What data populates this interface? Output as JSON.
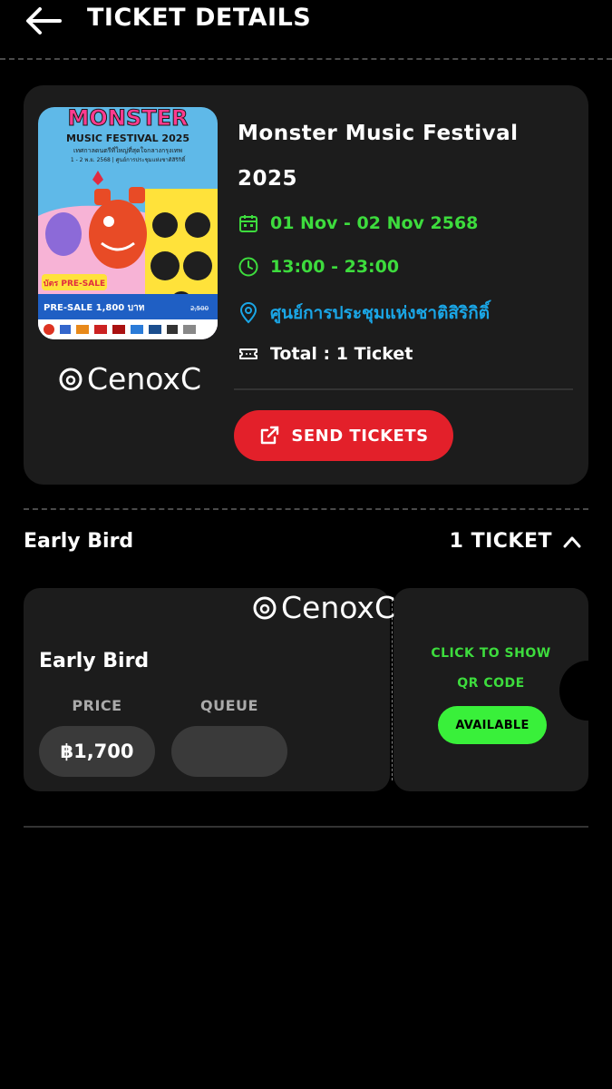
{
  "header": {
    "title": "TICKET DETAILS",
    "back_icon": "arrow-left-icon"
  },
  "event": {
    "title": "Monster Music Festival 2025",
    "date": "01 Nov - 02 Nov 2568",
    "time": "13:00 - 23:00",
    "venue": "ศูนย์การประชุมแห่งชาติสิริกิติ์",
    "total": "Total : 1 Ticket",
    "send_label": "SEND TICKETS",
    "poster": {
      "headline": "MONSTER",
      "subline": "MUSIC FESTIVAL 2025",
      "thai_line": "เทศกาลดนตรีที่ใหญ่ที่สุดใจกลางกรุงเทพ",
      "dates_line": "1 - 2 พ.ย. 2568 | ศูนย์การประชุมแห่งชาติสิริกิติ์",
      "badge": "บัตร PRE-SALE",
      "price_line": "PRE-SALE 1,800 บาท",
      "price_original": "2,500"
    }
  },
  "watermark": "CenoxC",
  "section": {
    "label": "Early Bird",
    "count": "1 TICKET"
  },
  "ticket": {
    "name": "Early Bird",
    "price_label": "PRICE",
    "price_value": "฿1,700",
    "queue_label": "QUEUE",
    "queue_value": "",
    "qr_line1": "CLICK TO SHOW",
    "qr_line2": "QR CODE",
    "status": "AVAILABLE"
  },
  "colors": {
    "accent_red": "#e3202a",
    "green": "#3ddc3d",
    "available_green": "#39f03a",
    "venue_blue": "#1aa6e6",
    "card_bg": "#1c1c1c"
  }
}
